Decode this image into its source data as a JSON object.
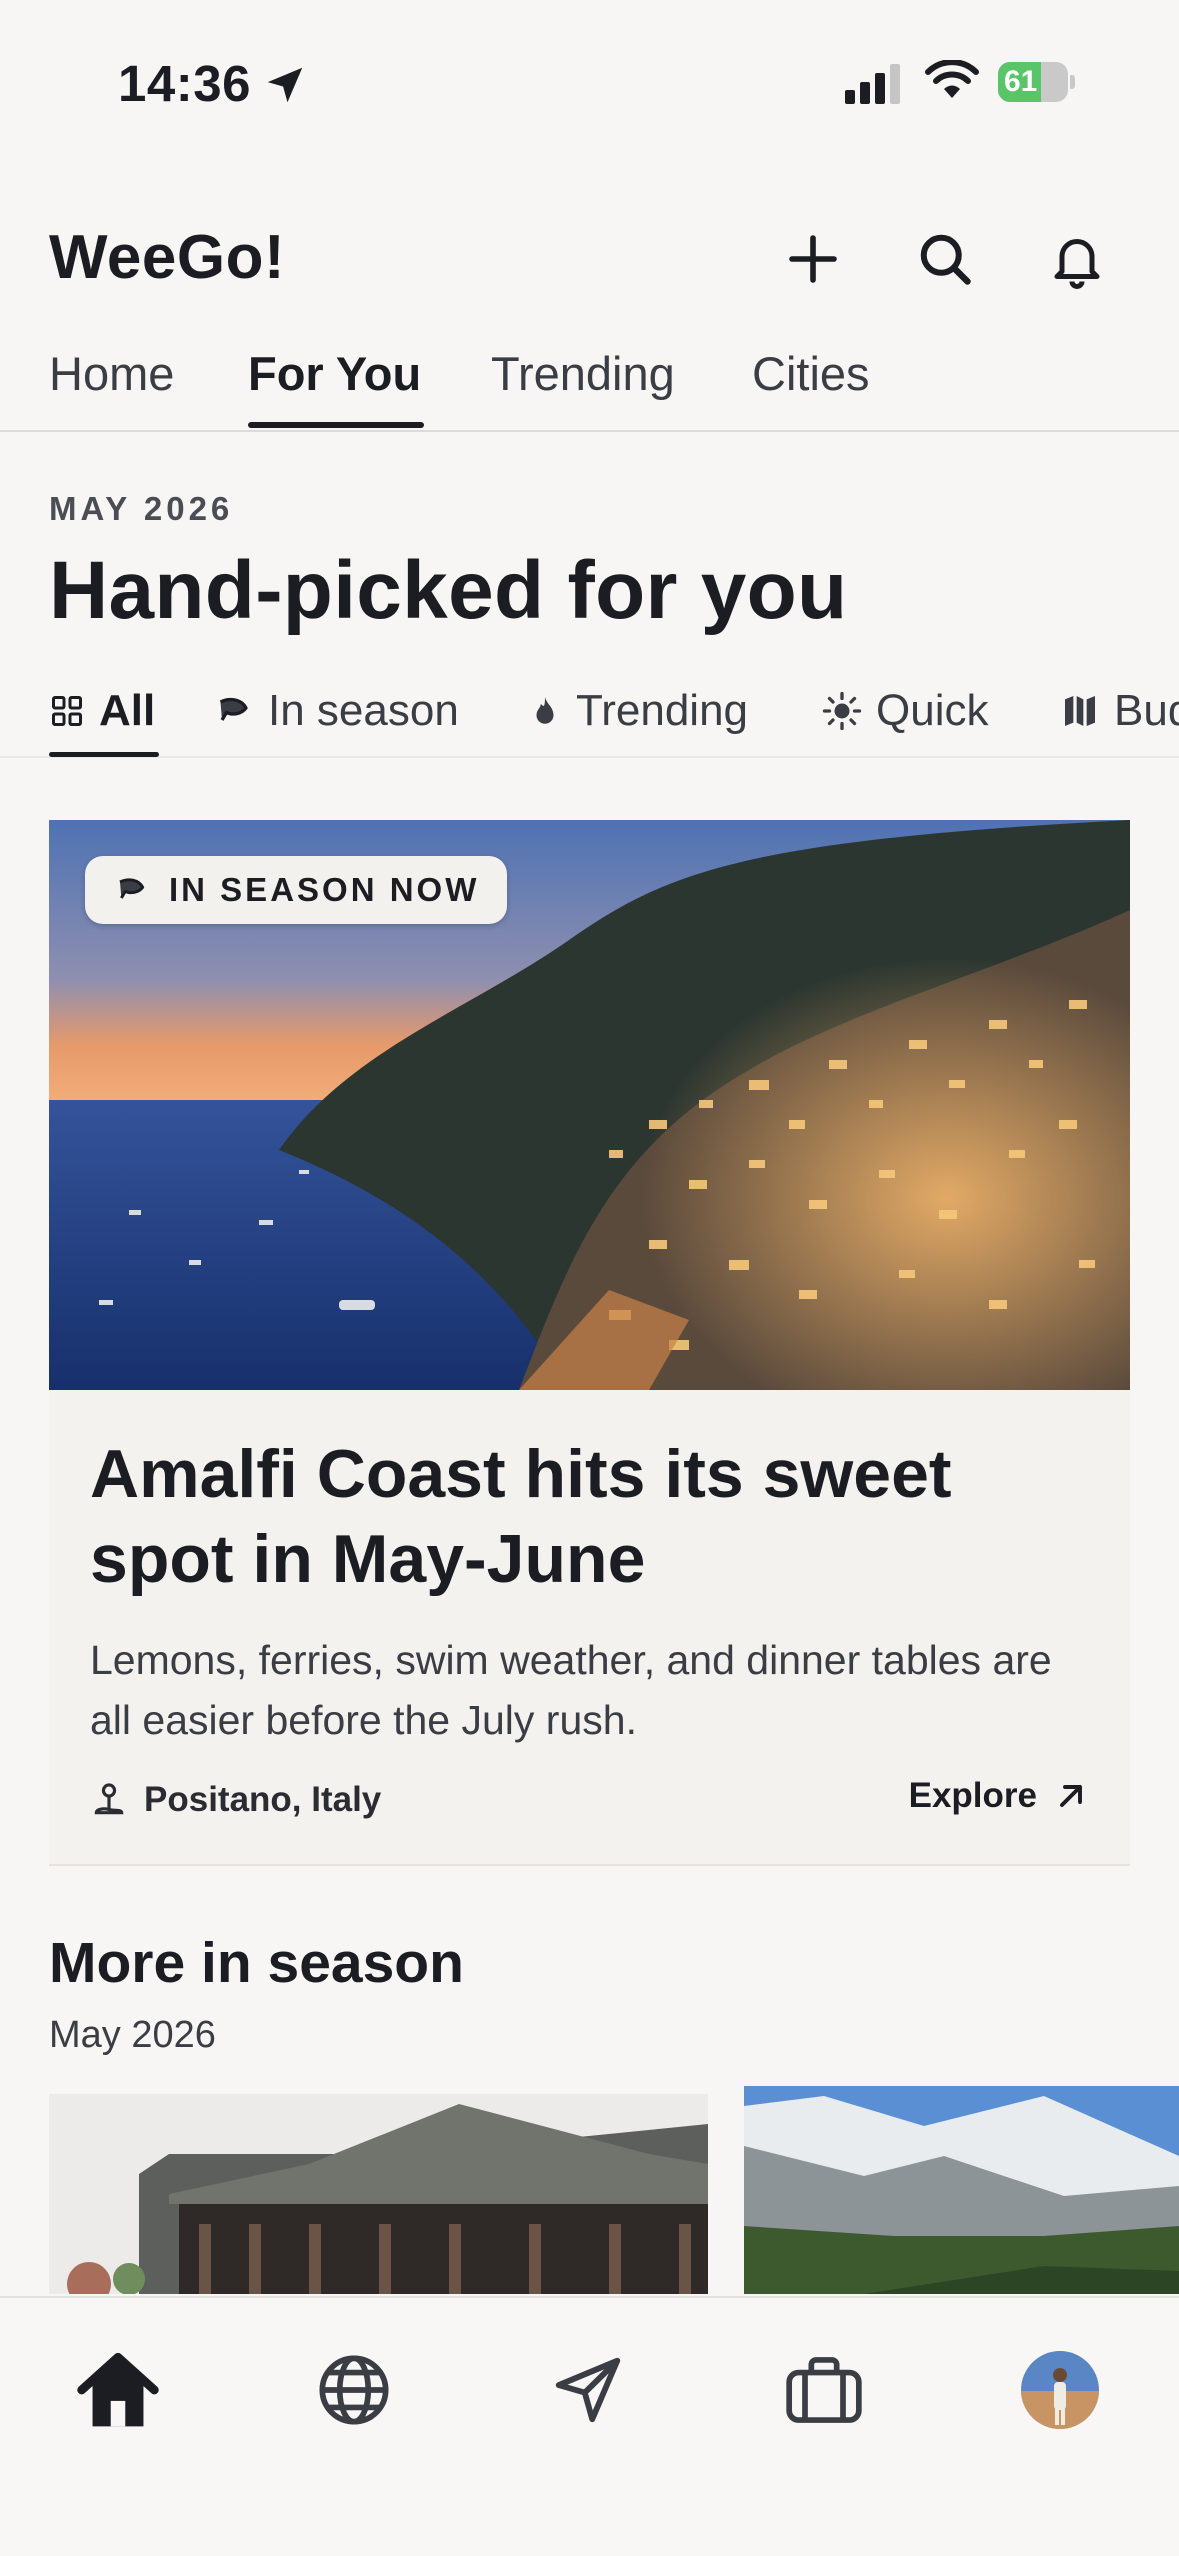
{
  "status_bar": {
    "time": "14:36",
    "battery_percent": 61,
    "battery_label": "61"
  },
  "header": {
    "app_title": "WeeGo!",
    "actions": [
      {
        "name": "add-button",
        "icon": "plus-icon"
      },
      {
        "name": "search-button",
        "icon": "search-icon"
      },
      {
        "name": "notifications-button",
        "icon": "bell-icon"
      }
    ]
  },
  "top_tabs": [
    {
      "label": "Home",
      "active": false
    },
    {
      "label": "For You",
      "active": true
    },
    {
      "label": "Trending",
      "active": false
    },
    {
      "label": "Cities",
      "active": false
    }
  ],
  "section": {
    "overline": "MAY 2026",
    "title": "Hand-picked for you"
  },
  "filters": [
    {
      "label": "All",
      "icon": "grid-icon",
      "active": true
    },
    {
      "label": "In season",
      "icon": "leaf-icon",
      "active": false
    },
    {
      "label": "Trending",
      "icon": "flame-icon",
      "active": false
    },
    {
      "label": "Quick",
      "icon": "sun-icon",
      "active": false
    },
    {
      "label": "Bud",
      "icon": "map-icon",
      "active": false
    }
  ],
  "featured": {
    "badge": "IN SEASON NOW",
    "title": "Amalfi Coast hits its sweet spot in May-June",
    "description": "Lemons, ferries, swim weather, and dinner tables are all easier before the July rush.",
    "location": "Positano, Italy",
    "cta": "Explore"
  },
  "more": {
    "title": "More in season",
    "subtitle": "May 2026"
  },
  "bottom_nav": [
    {
      "name": "home",
      "icon": "home-icon",
      "active": true
    },
    {
      "name": "explore",
      "icon": "globe-icon",
      "active": false
    },
    {
      "name": "trips",
      "icon": "send-icon",
      "active": false
    },
    {
      "name": "bookings",
      "icon": "briefcase-icon",
      "active": false
    },
    {
      "name": "profile",
      "icon": "avatar",
      "active": false
    }
  ],
  "colors": {
    "background": "#f7f6f4",
    "text": "#1c1d22",
    "battery_green": "#5ac469"
  }
}
